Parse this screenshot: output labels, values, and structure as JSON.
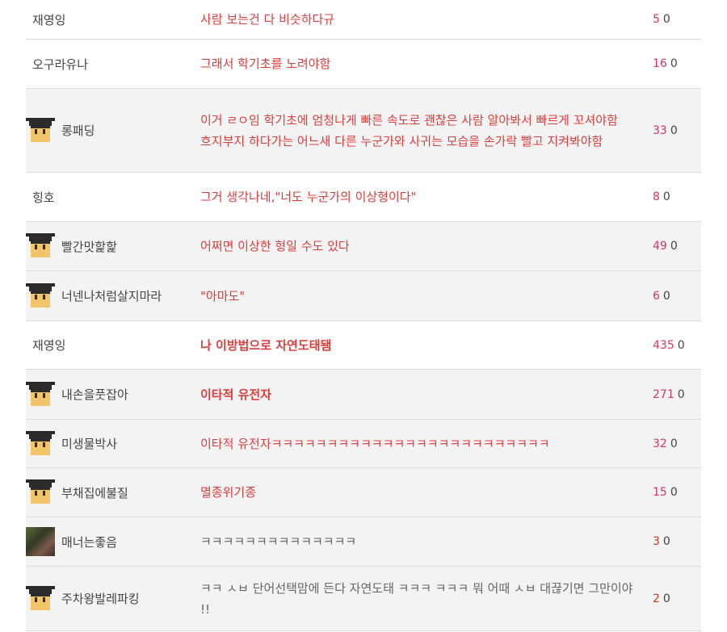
{
  "comments": [
    {
      "user": "재영잉",
      "avatar": "none",
      "text": "사람 보는건 다 비슷하다규",
      "likes": "5",
      "dislikes": "0",
      "style": "normal"
    },
    {
      "user": "오구라유나",
      "avatar": "none",
      "text": "그래서 학기초를 노려야함",
      "likes": "16",
      "dislikes": "0",
      "style": "normal"
    },
    {
      "user": "롱패딩",
      "avatar": "pixel-avatar",
      "text": "이거 ㄹㅇ임 학기초에 엄청나게 빠른 속도로 괜찮은 사람 알아봐서 빠르게 꼬셔야함 흐지부지 하다가는 어느새 다른 누군가와 사귀는 모습을 손가락 빨고 지켜봐야함",
      "likes": "33",
      "dislikes": "0",
      "style": "normal"
    },
    {
      "user": "힝호",
      "avatar": "none",
      "text": "그거 생각나네,\"너도 누군가의 이상형이다\"",
      "likes": "8",
      "dislikes": "0",
      "style": "normal"
    },
    {
      "user": "빨간맛핥핥",
      "avatar": "pixel-avatar",
      "text": "어쩌면 이상한 형일 수도 있다",
      "likes": "49",
      "dislikes": "0",
      "style": "normal"
    },
    {
      "user": "너넨나처럼살지마라",
      "avatar": "pixel-avatar",
      "text": "\"아마도\"",
      "likes": "6",
      "dislikes": "0",
      "style": "normal"
    },
    {
      "user": "재영잉",
      "avatar": "none",
      "text": "나 이방법으로 자연도태됌",
      "likes": "435",
      "dislikes": "0",
      "style": "bold"
    },
    {
      "user": "내손을풋잡아",
      "avatar": "pixel-avatar",
      "text": "이타적 유전자",
      "likes": "271",
      "dislikes": "0",
      "style": "bold"
    },
    {
      "user": "미생물박사",
      "avatar": "pixel-avatar",
      "text": "이타적 유전자ㅋㅋㅋㅋㅋㅋㅋㅋㅋㅋㅋㅋㅋㅋㅋㅋㅋㅋㅋㅋㅋㅋㅋㅋㅋ",
      "likes": "32",
      "dislikes": "0",
      "style": "normal"
    },
    {
      "user": "부채집에불질",
      "avatar": "pixel-avatar",
      "text": "멸종위기종",
      "likes": "15",
      "dislikes": "0",
      "style": "normal"
    },
    {
      "user": "매너는좋음",
      "avatar": "photo-avatar",
      "text": "ㅋㅋㅋㅋㅋㅋㅋㅋㅋㅋㅋㅋㅋㅋ",
      "likes": "3",
      "dislikes": "0",
      "style": "gray"
    },
    {
      "user": "주차왕발레파킹",
      "avatar": "pixel-avatar",
      "text": "ㅋㅋ ㅅㅂ 단어선택맘에 든다 자연도태 ㅋㅋㅋ ㅋㅋㅋ 뭐 어때 ㅅㅂ 대끊기면 그만이야 !!",
      "likes": "2",
      "dislikes": "0",
      "style": "gray"
    }
  ]
}
